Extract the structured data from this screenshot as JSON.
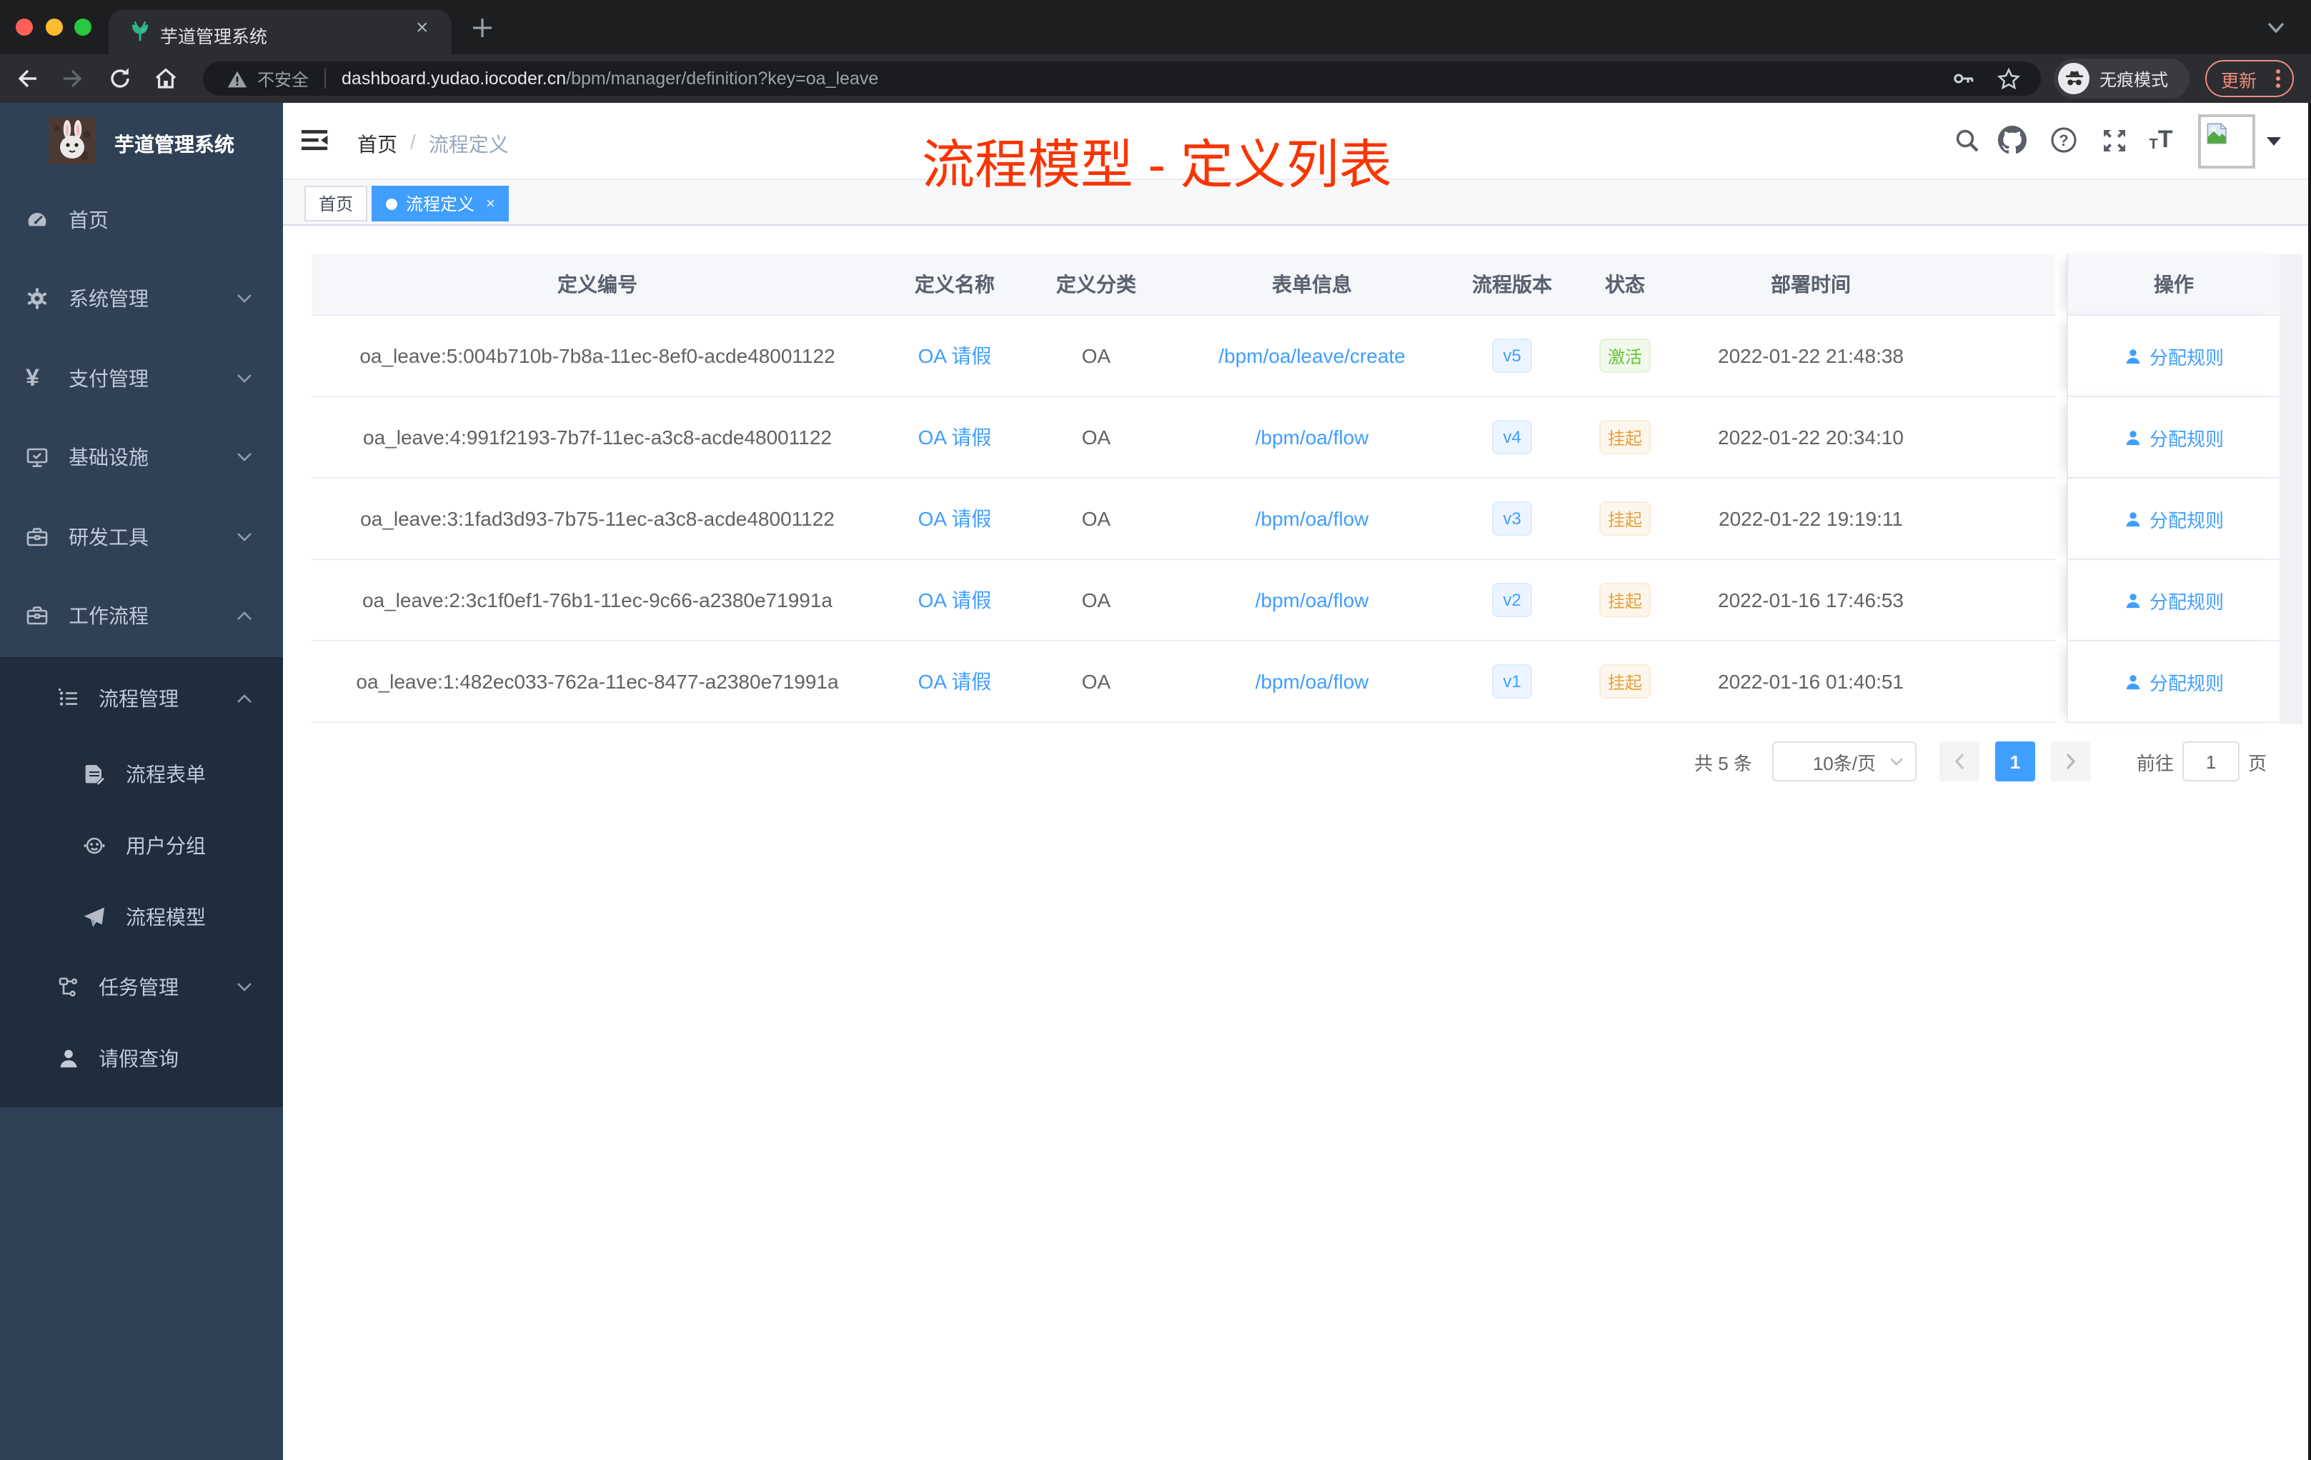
{
  "browser": {
    "tab_title": "芋道管理系统",
    "not_secure": "不安全",
    "url_domain": "dashboard.yudao.iocoder.cn",
    "url_path": "/bpm/manager/definition?key=oa_leave",
    "incognito_label": "无痕模式",
    "update_label": "更新"
  },
  "sidebar": {
    "logo_title": "芋道管理系统",
    "items": [
      {
        "label": "首页"
      },
      {
        "label": "系统管理"
      },
      {
        "label": "支付管理"
      },
      {
        "label": "基础设施"
      },
      {
        "label": "研发工具"
      },
      {
        "label": "工作流程"
      }
    ],
    "submenu": [
      {
        "label": "流程管理"
      },
      {
        "label": "流程表单"
      },
      {
        "label": "用户分组"
      },
      {
        "label": "流程模型"
      },
      {
        "label": "任务管理"
      },
      {
        "label": "请假查询"
      }
    ]
  },
  "header": {
    "breadcrumb_home": "首页",
    "breadcrumb_sep": "/",
    "breadcrumb_current": "流程定义"
  },
  "annotation": "流程模型 - 定义列表",
  "tags": [
    {
      "label": "首页"
    },
    {
      "label": "流程定义"
    }
  ],
  "table": {
    "columns": [
      "定义编号",
      "定义名称",
      "定义分类",
      "表单信息",
      "流程版本",
      "状态",
      "部署时间",
      "操作"
    ],
    "action_label": "分配规则",
    "rows": [
      {
        "id": "oa_leave:5:004b710b-7b8a-11ec-8ef0-acde48001122",
        "name": "OA 请假",
        "category": "OA",
        "form": "/bpm/oa/leave/create",
        "version": "v5",
        "status": "激活",
        "status_type": "success",
        "time": "2022-01-22 21:48:38"
      },
      {
        "id": "oa_leave:4:991f2193-7b7f-11ec-a3c8-acde48001122",
        "name": "OA 请假",
        "category": "OA",
        "form": "/bpm/oa/flow",
        "version": "v4",
        "status": "挂起",
        "status_type": "warning",
        "time": "2022-01-22 20:34:10"
      },
      {
        "id": "oa_leave:3:1fad3d93-7b75-11ec-a3c8-acde48001122",
        "name": "OA 请假",
        "category": "OA",
        "form": "/bpm/oa/flow",
        "version": "v3",
        "status": "挂起",
        "status_type": "warning",
        "time": "2022-01-22 19:19:11"
      },
      {
        "id": "oa_leave:2:3c1f0ef1-76b1-11ec-9c66-a2380e71991a",
        "name": "OA 请假",
        "category": "OA",
        "form": "/bpm/oa/flow",
        "version": "v2",
        "status": "挂起",
        "status_type": "warning",
        "time": "2022-01-16 17:46:53"
      },
      {
        "id": "oa_leave:1:482ec033-762a-11ec-8477-a2380e71991a",
        "name": "OA 请假",
        "category": "OA",
        "form": "/bpm/oa/flow",
        "version": "v1",
        "status": "挂起",
        "status_type": "warning",
        "time": "2022-01-16 01:40:51"
      }
    ]
  },
  "pagination": {
    "total": "共 5 条",
    "page_size": "10条/页",
    "page": "1",
    "goto_label": "前往",
    "goto_value": "1",
    "unit_label": "页"
  }
}
